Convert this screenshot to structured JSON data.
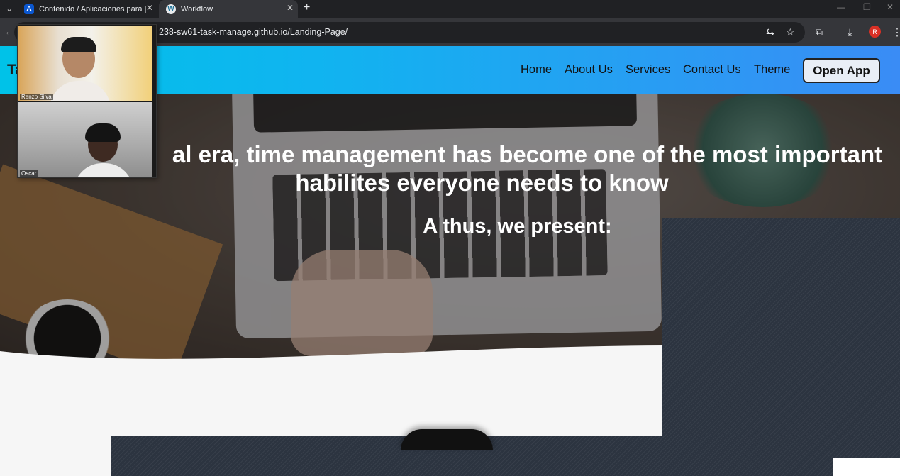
{
  "browser": {
    "tabs": [
      {
        "title": "Contenido / Aplicaciones para |",
        "favicon": "A",
        "active": false
      },
      {
        "title": "Workflow",
        "favicon": "W",
        "active": true
      }
    ],
    "url": "238-sw61-task-manage.github.io/Landing-Page/",
    "profile_initial": "R"
  },
  "site": {
    "brand": "Ta",
    "nav": [
      "Home",
      "About Us",
      "Services",
      "Contact Us",
      "Theme"
    ],
    "open_app_label": "Open App"
  },
  "hero": {
    "title_line1": "al era, time management has become one of the most important",
    "title_line2": "habilites everyone needs to know",
    "subtitle": "A thus, we present:"
  },
  "video_call": {
    "participants": [
      "Renzo Silva",
      "Oscar"
    ]
  },
  "colors": {
    "nav_gradient_start": "#00c2e8",
    "nav_gradient_end": "#3a8cf5",
    "dark_panel": "#2c3440"
  }
}
